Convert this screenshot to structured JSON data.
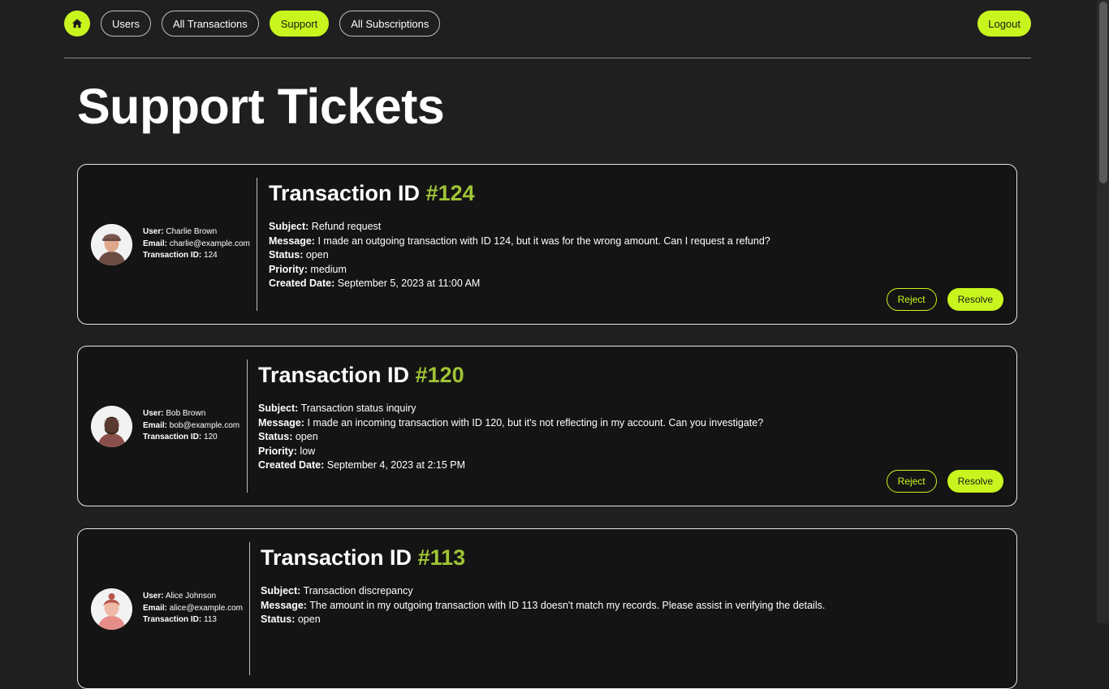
{
  "nav": {
    "home_icon": "home-icon",
    "links": [
      {
        "label": "Users"
      },
      {
        "label": "All Transactions"
      },
      {
        "label": "Support"
      },
      {
        "label": "All Subscriptions"
      }
    ],
    "active_label": "Support",
    "logout_label": "Logout"
  },
  "page_title": "Support Tickets",
  "labels": {
    "user": "User:",
    "email": "Email:",
    "transaction_id": "Transaction ID:",
    "subject": "Subject:",
    "message": "Message:",
    "status": "Status:",
    "priority": "Priority:",
    "created_date": "Created Date:",
    "title_prefix": "Transaction ID",
    "reject": "Reject",
    "resolve": "Resolve"
  },
  "tickets": [
    {
      "user": "Charlie Brown",
      "email": "charlie@example.com",
      "transaction_id": "124",
      "title_number": "#124",
      "subject": "Refund request",
      "message": "I made an outgoing transaction with ID 124, but it was for the wrong amount. Can I request a refund?",
      "status": "open",
      "priority": "medium",
      "created_date": "September 5, 2023 at 11:00 AM"
    },
    {
      "user": "Bob Brown",
      "email": "bob@example.com",
      "transaction_id": "120",
      "title_number": "#120",
      "subject": "Transaction status inquiry",
      "message": "I made an incoming transaction with ID 120, but it's not reflecting in my account. Can you investigate?",
      "status": "open",
      "priority": "low",
      "created_date": "September 4, 2023 at 2:15 PM"
    },
    {
      "user": "Alice Johnson",
      "email": "alice@example.com",
      "transaction_id": "113",
      "title_number": "#113",
      "subject": "Transaction discrepancy",
      "message": "The amount in my outgoing transaction with ID 113 doesn't match my records. Please assist in verifying the details.",
      "status": "open"
    }
  ],
  "colors": {
    "accent": "#c8f51e",
    "id_green": "#9fc436",
    "background": "#1f1f1f",
    "card": "#141414"
  }
}
